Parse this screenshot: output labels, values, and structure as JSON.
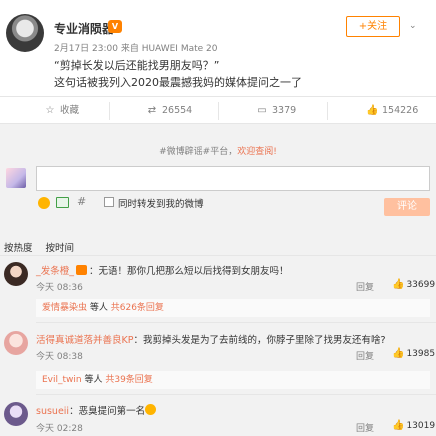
{
  "post": {
    "author": "专业消陨器",
    "meta": "2月17日 23:00 来自 HUAWEI Mate 20",
    "follow_label": "+关注",
    "text_line1": "“剪掉长发以后还能找男朋友吗？”",
    "text_line2": "这句话被我列入2020最震撼我妈的媒体提问之一了"
  },
  "actions": {
    "favorite": "收藏",
    "repost": "26554",
    "comment": "3379",
    "like": "154226"
  },
  "notice": {
    "prefix": "#微博辟谣#平台，",
    "link": "欢迎查阅!"
  },
  "composer": {
    "repost_label": "同时转发到我的微博",
    "submit_label": "评论"
  },
  "sort": {
    "hot": "按热度",
    "time": "按时间"
  },
  "comments": [
    {
      "user": "_发条橙_",
      "text": "：无语！那你几把那么短以后找得到女朋友吗！",
      "time": "今天 08:36",
      "reply": "回复",
      "likes": "33699",
      "more_user": "爱情暴染虫",
      "more_mid": " 等人 ",
      "more_count": "共626条回复"
    },
    {
      "user": "活得真诚道落并善良KP",
      "text": "：我剪掉头发是为了去前线的，你脖子里除了找男友还有啥?",
      "time": "今天 08:38",
      "reply": "回复",
      "likes": "13985",
      "more_user": "Evil_twin",
      "more_mid": " 等人 ",
      "more_count": "共39条回复"
    },
    {
      "user": "susueii",
      "text": "：恶臭提问第一名",
      "time": "今天 02:28",
      "reply": "回复",
      "likes": "13019"
    }
  ]
}
